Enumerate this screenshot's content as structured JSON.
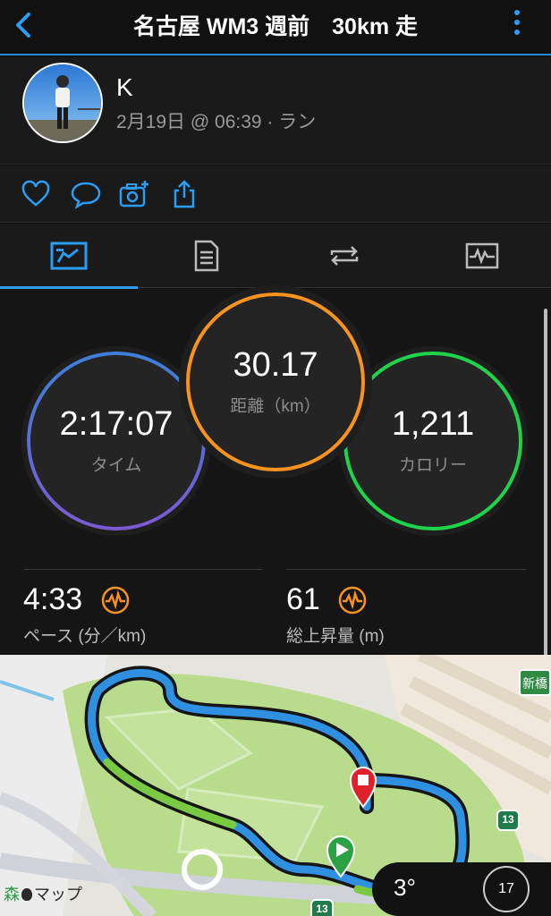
{
  "header": {
    "title": "名古屋 WM3 週前　30km 走"
  },
  "profile": {
    "name": "K",
    "meta": "2月19日 @ 06:39 · ラン"
  },
  "tabs": [
    {
      "icon": "summary-chart-icon",
      "active": true
    },
    {
      "icon": "details-list-icon",
      "active": false
    },
    {
      "icon": "laps-repeat-icon",
      "active": false
    },
    {
      "icon": "graph-monitor-icon",
      "active": false
    }
  ],
  "stats": {
    "time": {
      "value": "2:17:07",
      "label": "タイム"
    },
    "distance": {
      "value": "30.17",
      "label": "距離（km）"
    },
    "calories": {
      "value": "1,211",
      "label": "カロリー"
    },
    "pace": {
      "value": "4:33",
      "label": "ペース (分／km)"
    },
    "elevation": {
      "value": "61",
      "label": "総上昇量 (m)"
    }
  },
  "map": {
    "attribution": "マップ",
    "place_label": "森",
    "sign": "新橋",
    "route_shields": [
      "13",
      "13"
    ],
    "weather": {
      "temp": "3°",
      "wind": "17"
    }
  },
  "colors": {
    "accent": "#2b9df4",
    "time_ring": "#4d7bd8",
    "distance_ring": "#f7931e",
    "calories_ring": "#1fd34a",
    "route": "#2f8fe0",
    "route_alt": "#7ac943"
  }
}
